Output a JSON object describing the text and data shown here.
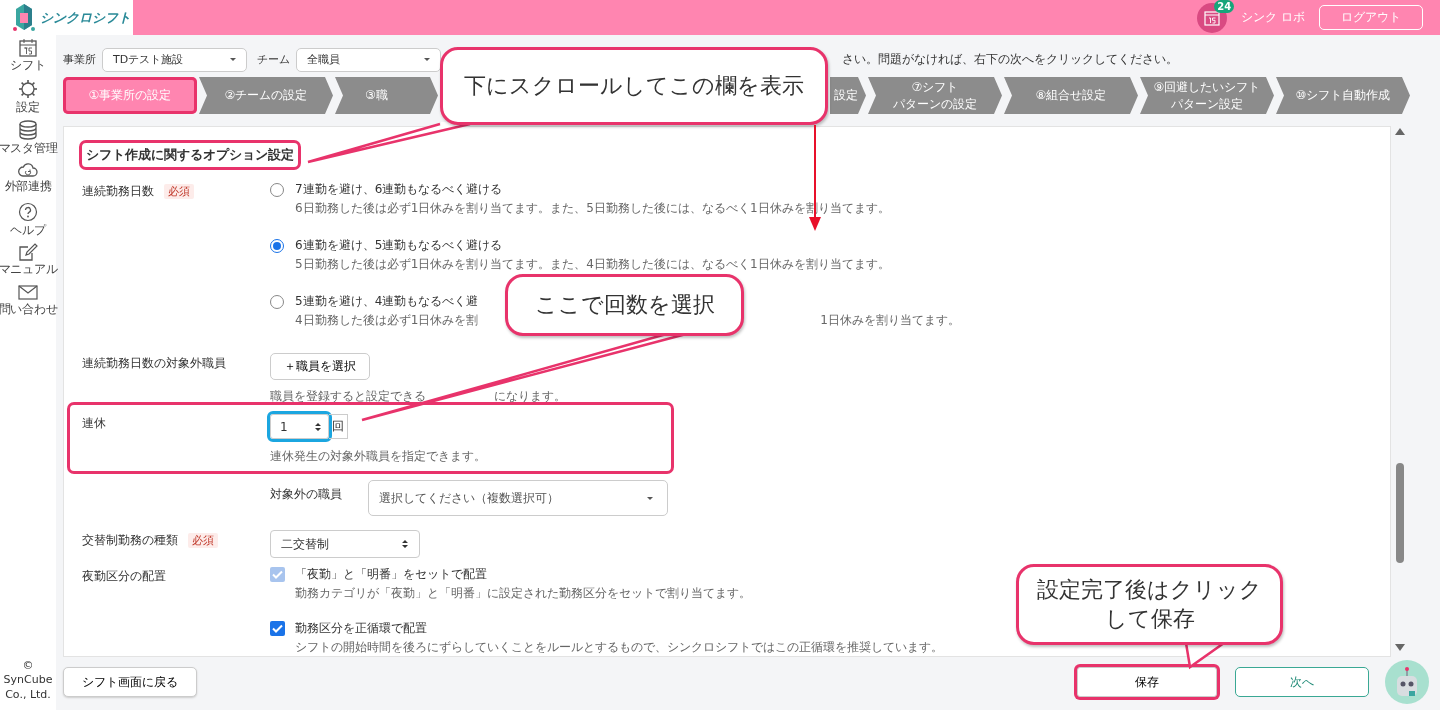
{
  "header": {
    "app_name": "シンクロシフト",
    "badge": "24",
    "user": "シンク ロボ",
    "logout": "ログアウト"
  },
  "sidebar": {
    "items": [
      {
        "label": "シフト"
      },
      {
        "label": "設定"
      },
      {
        "label": "マスタ管理"
      },
      {
        "label": "外部連携"
      },
      {
        "label": "ヘルプ"
      },
      {
        "label": "マニュアル"
      },
      {
        "label": "問い合わせ"
      }
    ],
    "copyright": "© SynCube Co., Ltd."
  },
  "filters": [
    {
      "label": "事業所",
      "value": "TDテスト施設"
    },
    {
      "label": "チーム",
      "value": "全職員"
    }
  ],
  "instruction": "さい。問題がなければ、右下の次へをクリックしてください。",
  "steps": [
    {
      "lines": [
        "①事業所の設定"
      ],
      "selected": true,
      "highlighted": true,
      "kind": "full"
    },
    {
      "lines": [
        "②チームの設定"
      ],
      "selected": false,
      "highlighted": false,
      "kind": "full"
    },
    {
      "lines": [
        "③職"
      ],
      "selected": false,
      "highlighted": false,
      "kind": "head"
    },
    {
      "lines": [
        "設定"
      ],
      "selected": false,
      "highlighted": false,
      "kind": "tail"
    },
    {
      "lines": [
        "⑦シフト",
        "パターンの設定"
      ],
      "selected": false,
      "highlighted": false,
      "kind": "full"
    },
    {
      "lines": [
        "⑧組合せ設定"
      ],
      "selected": false,
      "highlighted": false,
      "kind": "full"
    },
    {
      "lines": [
        "⑨回避したいシフト",
        "パターン設定"
      ],
      "selected": false,
      "highlighted": false,
      "kind": "full"
    },
    {
      "lines": [
        "⑩シフト自動作成"
      ],
      "selected": false,
      "highlighted": false,
      "kind": "full"
    }
  ],
  "section": {
    "title": "シフト作成に関するオプション設定",
    "highlighted": true
  },
  "fields": [
    {
      "kind": "radio",
      "label": "連続勤務日数",
      "required": "必須",
      "options": [
        {
          "label": "7連勤を避け、6連勤もなるべく避ける",
          "description": "6日勤務した後は必ず1日休みを割り当てます。また、5日勤務した後には、なるべく1日休みを割り当てます。",
          "selected": false
        },
        {
          "label": "6連勤を避け、5連勤もなるべく避ける",
          "description": "5日勤務した後は必ず1日休みを割り当てます。また、4日勤務した後には、なるべく1日休みを割り当てます。",
          "selected": true
        },
        {
          "label": "5連勤を避け、4連勤もなるべく避",
          "description": "4日勤務した後は必ず1日休みを割",
          "description_tail": "1日休みを割り当てます。",
          "selected": false
        }
      ]
    },
    {
      "kind": "button",
      "label": "連続勤務日数の対象外職員",
      "button": "＋職員を選択",
      "hint": [
        "職員を登録すると設定できる",
        "になります。"
      ]
    },
    {
      "kind": "stepper",
      "label": "連休",
      "value": "1",
      "unit": "回",
      "hint": "連休発生の対象外職員を指定できます。",
      "highlighted": true,
      "stepper_highlighted": true,
      "sublabel": "対象外の職員",
      "placeholder": "選択してください（複数選択可）"
    },
    {
      "kind": "select",
      "label": "交替制勤務の種類",
      "required": "必須",
      "value": "二交替制"
    },
    {
      "kind": "checkbox",
      "label": "夜勤区分の配置",
      "options": [
        {
          "label": "「夜勤」と「明番」をセットで配置",
          "description": "勤務カテゴリが「夜勤」と「明番」に設定された勤務区分をセットで割り当てます。",
          "checked": true,
          "disabled": true
        },
        {
          "label": "勤務区分を正循環で配置",
          "description": "シフトの開始時間を後ろにずらしていくことをルールとするもので、シンクロシフトではこの正循環を推奨しています。",
          "checked": true,
          "disabled": false
        }
      ]
    }
  ],
  "footer": {
    "back": "シフト画面に戻る",
    "save": "保存",
    "save_highlighted": true,
    "next": "次へ"
  },
  "callouts": [
    {
      "lines": [
        "下にスクロールしてこの欄を表示"
      ]
    },
    {
      "lines": [
        "ここで回数を選択"
      ]
    },
    {
      "lines": [
        "設定完了後はクリック",
        "して保存"
      ]
    }
  ]
}
